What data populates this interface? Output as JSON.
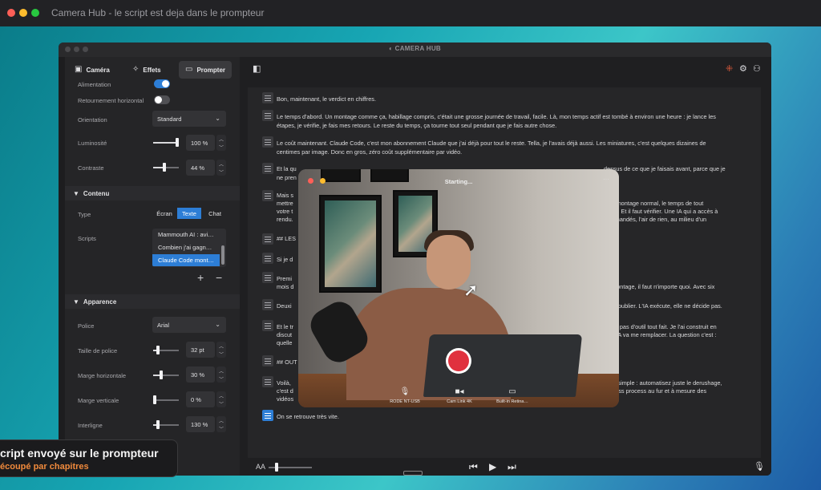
{
  "outer_window": {
    "title": "Camera Hub - le script est deja dans le prompteur"
  },
  "app": {
    "title": "CAMERA HUB"
  },
  "tabs": [
    {
      "label": "Caméra",
      "icon": "camera-icon"
    },
    {
      "label": "Effets",
      "icon": "magic-wand-icon"
    },
    {
      "label": "Prompter",
      "icon": "prompter-icon"
    }
  ],
  "camera_settings": {
    "alimentation_label": "Alimentation",
    "alimentation_on": true,
    "retournement_label": "Retournement horizontal",
    "retournement_on": false,
    "orientation_label": "Orientation",
    "orientation_value": "Standard",
    "luminosite_label": "Luminosité",
    "luminosite_value": "100 %",
    "luminosite_level": 1.0,
    "contraste_label": "Contraste",
    "contraste_value": "44 %",
    "contraste_level": 0.44
  },
  "contenu": {
    "section_title": "Contenu",
    "type_label": "Type",
    "type_options": [
      "Écran",
      "Texte",
      "Chat"
    ],
    "type_selected": "Texte",
    "scripts_label": "Scripts",
    "scripts": [
      "Mammouth AI : avi…",
      "Combien j'ai gagn…",
      "Claude Code mont…"
    ],
    "scripts_selected": "Claude Code mont…",
    "add_glyph": "+",
    "remove_glyph": "−"
  },
  "apparence": {
    "section_title": "Apparence",
    "police_label": "Police",
    "police_value": "Arial",
    "taille_label": "Taille de police",
    "taille_value": "32 pt",
    "taille_level": 0.15,
    "marge_h_label": "Marge horizontale",
    "marge_h_value": "30 %",
    "marge_h_level": 0.3,
    "marge_v_label": "Marge verticale",
    "marge_v_value": "0 %",
    "marge_v_level": 0.0,
    "interligne_label": "Interligne",
    "interligne_value": "130 %",
    "interligne_level": 0.15
  },
  "prompter_text": [
    "Bon, maintenant, le verdict en chiffres.",
    "Le temps d'abord. Un montage comme ça, habillage compris, c'était une grosse journée de travail, facile. Là, mon temps actif est tombé à environ une heure : je lance les étapes, je vérifie, je fais mes retours. Le reste du temps, ça tourne tout seul pendant que je fais autre chose.",
    "Le coût maintenant. Claude Code, c'est mon abonnement Claude que j'ai déjà pour tout le reste. Tella, je l'avais déjà aussi. Les miniatures, c'est quelques dizaines de centimes par image. Donc en gros, zéro coût supplémentaire par vidéo.",
    "Et la qu",
    "ne pren",
    "Mais s",
    "mettre",
    "votre t",
    "rendu.",
    "## LES",
    "Si je d",
    "Premi",
    "mois d",
    "Deuxi",
    "Et le tr",
    "discut",
    "quelle",
    "## OUT",
    "Voilà,",
    "c'est d",
    "vidéos",
    "On se retrouve très vite."
  ],
  "prompter_text_right": [
    "dessus de ce que je faisais avant, parce que je",
    "d'un montage normal, le temps de tout",
    "vidéo. Et il faut vérifier. Une IA qui a accès à",
    "s demandés, l'air de rien, au milieu d'un",
    "de montage, il faut n'importe quoi. Avec six",
    "s sur publier. L'IA exécute, elle ne décide pas.",
    "ation, pas d'outil tout fait. Je l'ai construit en",
    "outil IA va me remplacer. La question c'est :",
    "ncez simple : automatisez juste le derushage,",
    "process process au fur et à mesure des"
  ],
  "camera_overlay": {
    "status": "Starting...",
    "devices": [
      {
        "label": "RODE NT-USB",
        "icon": "microphone-icon"
      },
      {
        "label": "Cam Link 4K",
        "icon": "video-camera-icon"
      },
      {
        "label": "Built-in Retina…",
        "icon": "display-icon"
      }
    ]
  },
  "bottom_bar": {
    "font_size_glyph": "AA"
  },
  "caption": {
    "line1": "cript envoyé sur le prompteur",
    "line2": "écoupé par chapitres"
  },
  "colors": {
    "accent": "#2d7ed6",
    "record": "#e0313e",
    "caption_accent": "#f08a3c"
  }
}
